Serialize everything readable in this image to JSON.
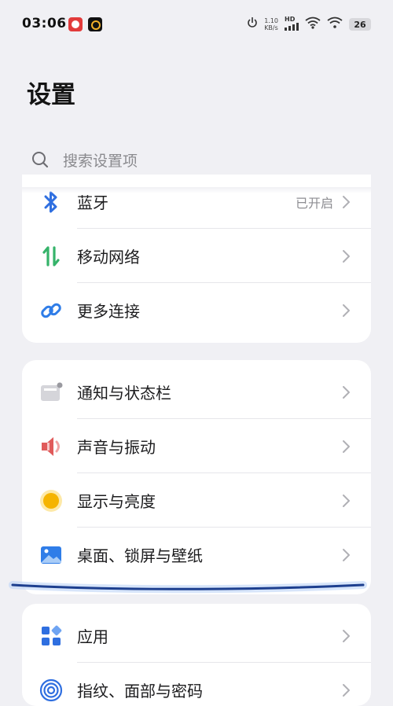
{
  "status_bar": {
    "time": "03:06",
    "net_speed_top": "1.10",
    "net_speed_unit": "KB/s",
    "signal_label": "HD",
    "battery": "26"
  },
  "page": {
    "title": "设置",
    "search_placeholder": "搜索设置项"
  },
  "groups": [
    {
      "items": [
        {
          "label": "蓝牙",
          "value": "已开启",
          "icon": "bluetooth-icon"
        },
        {
          "label": "移动网络",
          "icon": "mobile-network-icon"
        },
        {
          "label": "更多连接",
          "icon": "link-icon"
        }
      ]
    },
    {
      "items": [
        {
          "label": "通知与状态栏",
          "icon": "notification-icon"
        },
        {
          "label": "声音与振动",
          "icon": "speaker-icon"
        },
        {
          "label": "显示与亮度",
          "icon": "brightness-icon"
        },
        {
          "label": "桌面、锁屏与壁纸",
          "icon": "wallpaper-icon"
        }
      ]
    },
    {
      "items": [
        {
          "label": "应用",
          "icon": "apps-icon"
        },
        {
          "label": "指纹、面部与密码",
          "icon": "fingerprint-icon"
        }
      ]
    }
  ],
  "colors": {
    "background": "#f0f0f4",
    "card": "#ffffff",
    "bluetooth": "#2f6fe0",
    "mobile_network": "#35b36a",
    "link": "#2f7de8",
    "speaker": "#e05a5a",
    "brightness": "#f5b400",
    "wallpaper": "#2f7de8",
    "apps": "#2f6fe0"
  }
}
